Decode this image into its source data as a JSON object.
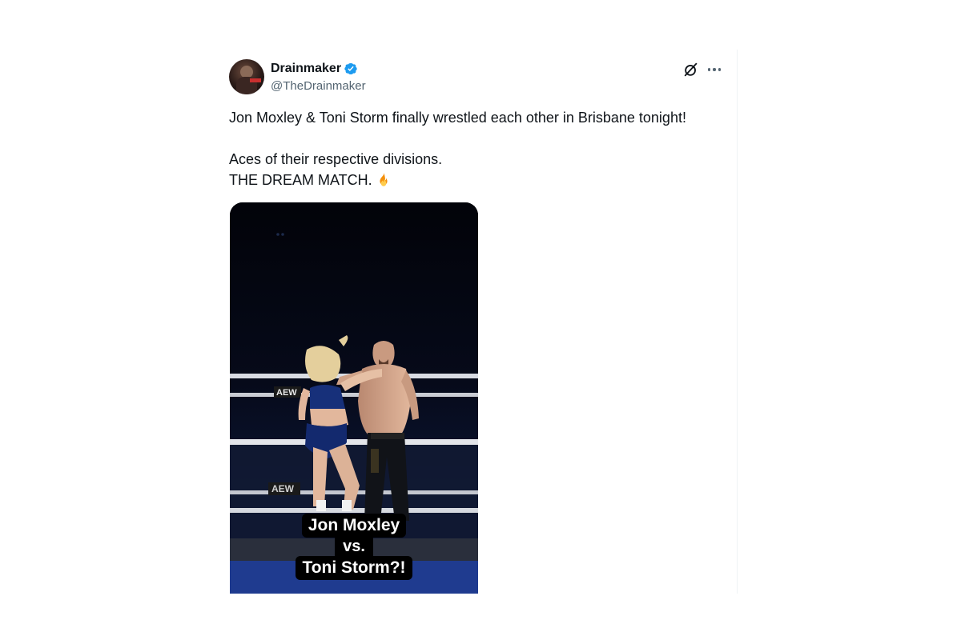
{
  "tweet": {
    "author": {
      "display_name": "Drainmaker",
      "handle": "@TheDrainmaker",
      "verified": true,
      "verified_color": "#1d9bf0"
    },
    "text_lines": [
      "Jon Moxley & Toni Storm finally wrestled each other in Brisbane tonight!",
      "Aces of their respective divisions.",
      "THE DREAM MATCH."
    ],
    "emoji": "fire-icon",
    "media": {
      "type": "video",
      "ring_sign_text": "AEW",
      "caption_lines": [
        "Jon Moxley",
        "vs.",
        "Toni Storm?!"
      ]
    },
    "actions": {
      "grok_icon": "grok-icon",
      "more_icon": "more-icon"
    }
  },
  "colors": {
    "text_primary": "#0f1419",
    "text_secondary": "#536471",
    "accent": "#1d9bf0"
  }
}
